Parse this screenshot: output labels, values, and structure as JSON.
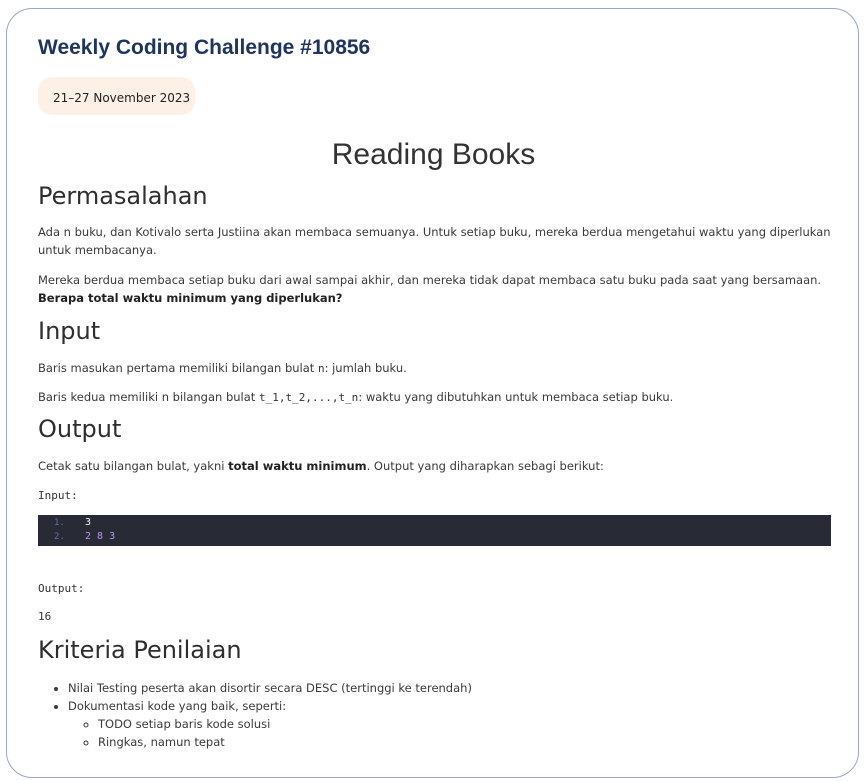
{
  "header": {
    "challenge_title": "Weekly Coding Challenge #10856",
    "date_range": "21–27 November 2023"
  },
  "problem": {
    "title": "Reading Books",
    "permasalahan": {
      "heading": "Permasalahan",
      "p1": "Ada n buku, dan Kotivalo serta Justiina akan membaca semuanya. Untuk setiap buku, mereka berdua mengetahui waktu yang diperlukan untuk membacanya.",
      "p2_pre": "Mereka berdua membaca setiap buku dari awal sampai akhir, dan mereka tidak dapat membaca satu buku pada saat yang bersamaan. ",
      "p2_bold": "Berapa total waktu minimum yang diperlukan?"
    },
    "input": {
      "heading": "Input",
      "line1_pre": "Baris masukan pertama memiliki bilangan bulat ",
      "line1_code": "n",
      "line1_post": ": jumlah buku.",
      "line2_pre": "Baris kedua memiliki n bilangan bulat ",
      "line2_code": "t_1,t_2,...,t_n",
      "line2_post": ": waktu yang dibutuhkan untuk membaca setiap buku."
    },
    "output": {
      "heading": "Output",
      "line_pre": "Cetak satu bilangan bulat, yakni ",
      "line_bold": "total waktu minimum",
      "line_post": ". Output yang diharapkan sebagi berikut:",
      "input_label": "Input:",
      "code_lines": [
        {
          "num": "1.",
          "text": "3"
        },
        {
          "num": "2.",
          "text": "2 8 3"
        }
      ],
      "output_label": "Output:",
      "output_value": "16"
    },
    "kriteria": {
      "heading": "Kriteria Penilaian",
      "items": [
        "Nilai Testing peserta akan disortir secara DESC (tertinggi ke terendah)",
        "Dokumentasi kode yang baik, seperti:"
      ],
      "subitems": [
        "TODO setiap baris kode solusi",
        "Ringkas, namun tepat"
      ]
    }
  },
  "colors": {
    "title": "#1f3460",
    "badge_bg": "#fdf1e7",
    "code_bg": "#282a36",
    "card_border": "#9aa6c2"
  }
}
